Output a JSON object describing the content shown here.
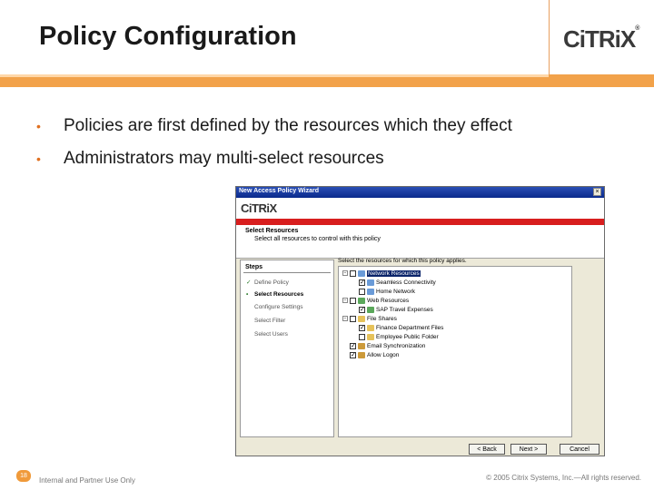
{
  "slide": {
    "title": "Policy Configuration",
    "logo": {
      "text_a": "CiTRiX",
      "mark": "®"
    },
    "bullets": [
      "Policies are first defined by the resources which they effect",
      "Administrators may multi-select resources"
    ],
    "footer": {
      "page_number": "18",
      "left": "Internal and Partner Use Only",
      "right": "© 2005 Citrix Systems, Inc.—All rights reserved."
    }
  },
  "wizard": {
    "title": "New Access Policy Wizard",
    "close_label": "×",
    "logo": "CiTRiX",
    "section_title": "Select Resources",
    "section_subtitle": "Select all resources to control with this policy",
    "steps_header": "Steps",
    "steps": [
      {
        "mark": "✓",
        "label": "Define Policy"
      },
      {
        "mark": "•",
        "label": "Select Resources"
      },
      {
        "mark": "",
        "label": "Configure Settings"
      },
      {
        "mark": "",
        "label": "Select Filter"
      },
      {
        "mark": "",
        "label": "Select Users"
      }
    ],
    "resources_label": "Select the resources for which this policy applies.",
    "tree": [
      {
        "expander": "−",
        "checked": "",
        "icon": "network",
        "label": "Network Resources",
        "selected": true,
        "indent": 0
      },
      {
        "expander": "",
        "checked": "✓",
        "icon": "network",
        "label": "Seamless Connectivity",
        "selected": false,
        "indent": 1
      },
      {
        "expander": "",
        "checked": "",
        "icon": "network",
        "label": "Home Network",
        "selected": false,
        "indent": 1
      },
      {
        "expander": "−",
        "checked": "",
        "icon": "web",
        "label": "Web Resources",
        "selected": false,
        "indent": 0
      },
      {
        "expander": "",
        "checked": "✓",
        "icon": "web",
        "label": "SAP Travel Expenses",
        "selected": false,
        "indent": 1
      },
      {
        "expander": "−",
        "checked": "",
        "icon": "share",
        "label": "File Shares",
        "selected": false,
        "indent": 0
      },
      {
        "expander": "",
        "checked": "✓",
        "icon": "share",
        "label": "Finance Department Files",
        "selected": false,
        "indent": 1
      },
      {
        "expander": "",
        "checked": "",
        "icon": "share",
        "label": "Employee Public Folder",
        "selected": false,
        "indent": 1
      },
      {
        "expander": "",
        "checked": "✓",
        "icon": "app",
        "label": "Email Synchronization",
        "selected": false,
        "indent": 0
      },
      {
        "expander": "",
        "checked": "✓",
        "icon": "app",
        "label": "Allow Logon",
        "selected": false,
        "indent": 0
      }
    ],
    "buttons": {
      "back": "< Back",
      "next": "Next >",
      "cancel": "Cancel"
    }
  }
}
